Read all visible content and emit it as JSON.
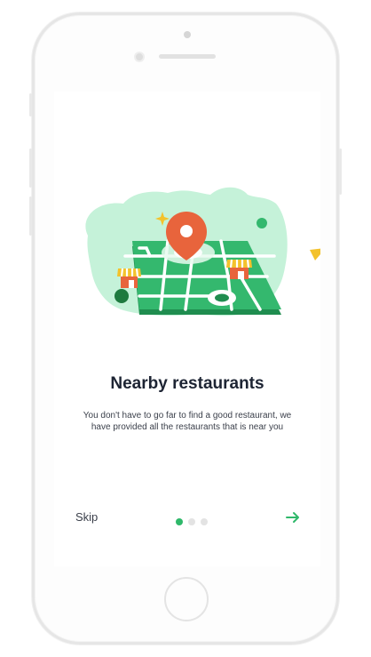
{
  "onboarding": {
    "title": "Nearby restaurants",
    "description": "You don't have to go far to find a good restaurant, we have provided all the restaurants that is near you",
    "skip_label": "Skip",
    "current_step": 1,
    "total_steps": 3
  },
  "colors": {
    "accent": "#2fb86a",
    "pin": "#e8643c",
    "blob": "#c5f2d9",
    "star": "#f3c22c",
    "title": "#1d2433",
    "dot_inactive": "#e3e3e3"
  },
  "icons": {
    "next": "arrow-right-icon",
    "illustration": "map-with-location-pin"
  }
}
